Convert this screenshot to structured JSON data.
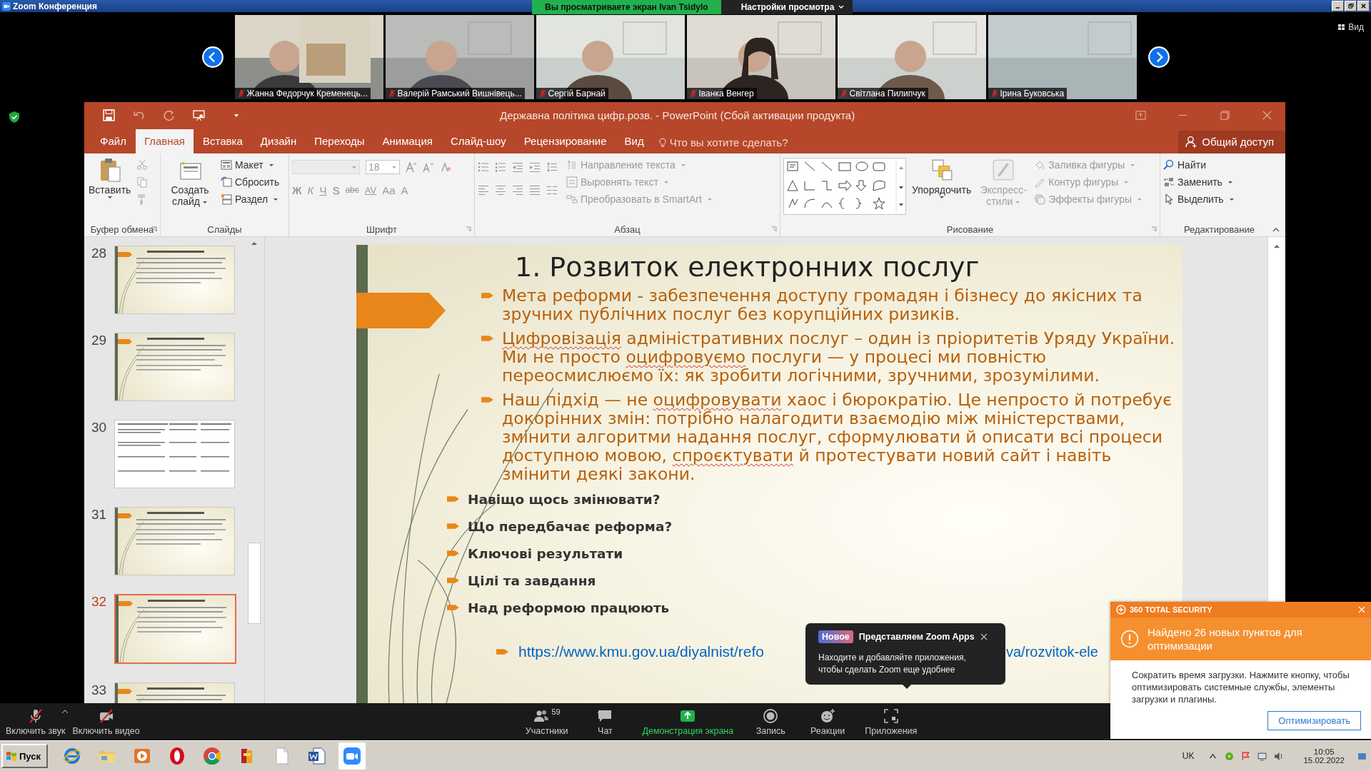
{
  "zoom_window": {
    "title": "Zoom Конференция",
    "share_banner": "Вы просматриваете экран Ivan Tsidylo",
    "view_settings": "Настройки просмотра",
    "view_button": "Вид"
  },
  "participants": [
    {
      "name": "Жанна Федорчук Кременець...",
      "muted": true
    },
    {
      "name": "Валерій Рамський Вишнівець...",
      "muted": true
    },
    {
      "name": "Сергій Барнай",
      "muted": true
    },
    {
      "name": "Іванка Венгер",
      "muted": true
    },
    {
      "name": "Світлана Пилипчук",
      "muted": true
    },
    {
      "name": "Ірина Буковська",
      "muted": true
    }
  ],
  "powerpoint": {
    "title": "Державна політика цифр.розв. - PowerPoint (Сбой активации продукта)",
    "tabs": [
      {
        "label": "Файл",
        "selected": false
      },
      {
        "label": "Главная",
        "selected": true
      },
      {
        "label": "Вставка",
        "selected": false
      },
      {
        "label": "Дизайн",
        "selected": false
      },
      {
        "label": "Переходы",
        "selected": false
      },
      {
        "label": "Анимация",
        "selected": false
      },
      {
        "label": "Слайд-шоу",
        "selected": false
      },
      {
        "label": "Рецензирование",
        "selected": false
      },
      {
        "label": "Вид",
        "selected": false
      }
    ],
    "tell_me": {
      "placeholder": "Что вы хотите сделать?"
    },
    "share_button": "Общий доступ",
    "ribbon": {
      "clipboard": {
        "label": "Буфер обмена",
        "paste": "Вставить"
      },
      "slides": {
        "label": "Слайды",
        "new_slide": "Создать слайд",
        "layout": "Макет",
        "reset": "Сбросить",
        "section": "Раздел"
      },
      "font": {
        "label": "Шрифт",
        "disabled": true,
        "size": "18",
        "format_buttons": [
          "Ж",
          "К",
          "Ч",
          "S",
          "abc",
          "AV",
          "Aa",
          "A"
        ]
      },
      "paragraph": {
        "label": "Абзац",
        "disabled": true,
        "text_direction": "Направление текста",
        "align_text": "Выровнять текст",
        "smartart": "Преобразовать в SmartArt"
      },
      "drawing": {
        "label": "Рисование",
        "arrange": "Упорядочить",
        "format_disabled": true,
        "quick_styles": "Экспресс-стили",
        "fill": "Заливка фигуры",
        "outline": "Контур фигуры",
        "effects": "Эффекты фигуры"
      },
      "editing": {
        "label": "Редактирование",
        "find": "Найти",
        "replace": "Заменить",
        "select": "Выделить"
      }
    }
  },
  "thumbnails": [
    {
      "number": "28",
      "kind": "text",
      "selected": false
    },
    {
      "number": "29",
      "kind": "text",
      "selected": false
    },
    {
      "number": "30",
      "kind": "table",
      "selected": false
    },
    {
      "number": "31",
      "kind": "text",
      "selected": false
    },
    {
      "number": "32",
      "kind": "text",
      "selected": true
    },
    {
      "number": "33",
      "kind": "text",
      "selected": false
    }
  ],
  "slide": {
    "title": "1. Розвиток електронних послуг",
    "bullets": [
      {
        "segments": [
          {
            "text": "Мета реформи - забезпечення доступу громадян і бізнесу до якісних та зручних публічних послуг без корупційних ризиків.",
            "misspelled": false
          }
        ]
      },
      {
        "segments": [
          {
            "text": "Цифровізація",
            "misspelled": true
          },
          {
            "text": " адміністративних послуг – один із пріоритетів Уряду України. Ми не просто ",
            "misspelled": false
          },
          {
            "text": "оцифровуємо",
            "misspelled": true
          },
          {
            "text": " послуги — у процесі ми повністю переосмислюємо їх: як зробити логічними, зручними, зрозумілими.",
            "misspelled": false
          }
        ]
      },
      {
        "segments": [
          {
            "text": "Наш підхід — не ",
            "misspelled": false
          },
          {
            "text": "оцифровувати",
            "misspelled": true
          },
          {
            "text": " хаос і бюрократію. Це непросто й потребує докорінних змін: потрібно налагодити взаємодію між міністерствами, змінити алгоритми надання послуг, сформулювати й описати всі процеси доступною мовою, ",
            "misspelled": false
          },
          {
            "text": "спроєктувати",
            "misspelled": true
          },
          {
            "text": " й протестувати новий сайт і навіть змінити деякі закони.",
            "misspelled": false
          }
        ]
      }
    ],
    "topics": [
      "Навіщо щось змінювати?",
      "Що передбачає реформа?",
      "Ключові результати",
      "Цілі та завдання",
      "Над реформою працюють"
    ],
    "link_start": "https://www.kmu.gov.ua/diyalnist/refo",
    "link_end": "va/rozvitok-ele"
  },
  "zoom_apps_tip": {
    "badge": "Новое",
    "title": "Представляем Zoom Apps",
    "body": "Находите и добавляйте приложения, чтобы сделать Zoom еще удобнее"
  },
  "zoom_toolbar": {
    "left": [
      {
        "label": "Включить звук",
        "kind": "mic_off"
      },
      {
        "label": "Включить видео",
        "kind": "video_off"
      }
    ],
    "center": [
      {
        "label": "Участники",
        "kind": "participants",
        "count": "59"
      },
      {
        "label": "Чат",
        "kind": "chat"
      },
      {
        "label": "Демонстрация экрана",
        "kind": "share"
      },
      {
        "label": "Запись",
        "kind": "record"
      },
      {
        "label": "Реакции",
        "kind": "reactions"
      },
      {
        "label": "Приложения",
        "kind": "apps"
      }
    ]
  },
  "security_popup": {
    "brand": "360 TOTAL SECURITY",
    "title": "Найдено 26 новых пунктов для оптимизации",
    "body": "Сократить время загрузки. Нажмите кнопку, чтобы оптимизировать системные службы, элементы загрузки и плагины.",
    "button": "Оптимизировать"
  },
  "taskbar": {
    "start": "Пуск",
    "language": "UK",
    "time": "10:05",
    "date": "15.02.2022"
  }
}
